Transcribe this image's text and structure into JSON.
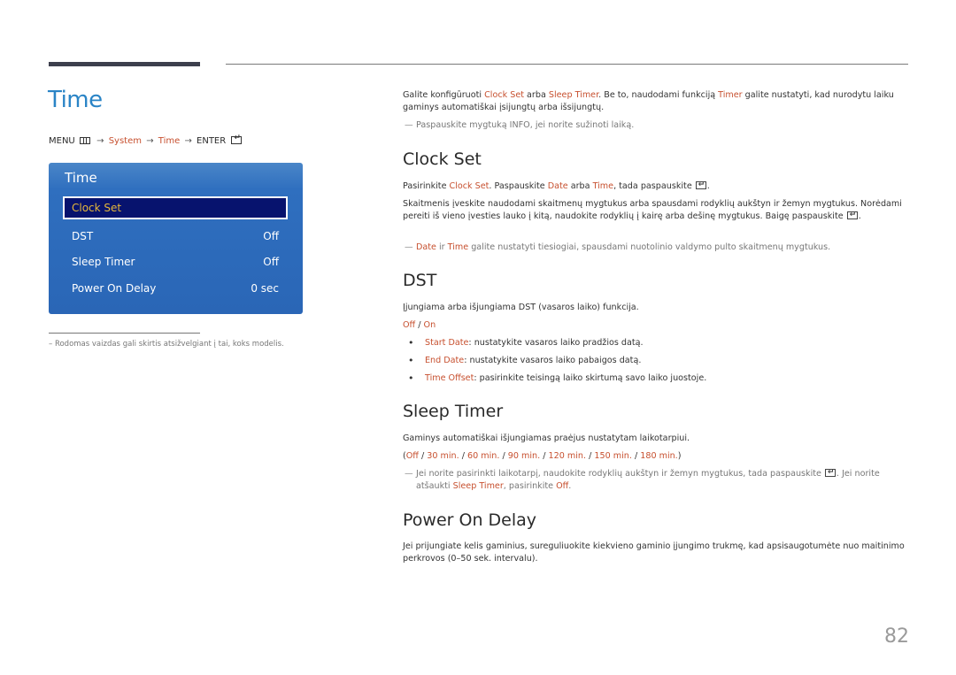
{
  "header": {
    "title": "Time",
    "menu_path": {
      "menu": "MENU",
      "menu_icon": "menu-grid-icon",
      "system": "System",
      "time": "Time",
      "enter": "ENTER",
      "enter_icon": "enter-icon",
      "arrow": "→"
    }
  },
  "osd": {
    "title": "Time",
    "items": [
      {
        "label": "Clock Set",
        "value": "",
        "selected": true
      },
      {
        "label": "DST",
        "value": "Off"
      },
      {
        "label": "Sleep Timer",
        "value": "Off"
      },
      {
        "label": "Power On Delay",
        "value": "0 sec"
      }
    ]
  },
  "footnote": "–  Rodomas vaizdas gali skirtis atsižvelgiant į tai, koks modelis.",
  "intro": {
    "t1": "Galite konfigūruoti ",
    "clock_set": "Clock Set",
    "t2": " arba ",
    "sleep_timer": "Sleep Timer",
    "t3": ". Be to, naudodami funkciją ",
    "timer": "Timer",
    "t4": " galite nustatyti, kad nurodytu laiku gaminys automatiškai įsijungtų arba išsijungtų.",
    "note": "Paspauskite mygtuką INFO, jei norite sužinoti laiką."
  },
  "clock_set": {
    "heading": "Clock Set",
    "p1_a": "Pasirinkite ",
    "p1_clock": "Clock Set",
    "p1_b": ". Paspauskite ",
    "p1_date": "Date",
    "p1_c": " arba ",
    "p1_time": "Time",
    "p1_d": ", tada paspauskite ",
    "p1_e": ".",
    "p2": "Skaitmenis įveskite naudodami skaitmenų mygtukus arba spausdami rodyklių aukštyn ir žemyn mygtukus. Norėdami pereiti iš vieno įvesties lauko į kitą, naudokite rodyklių į kairę arba dešinę mygtukus. Baigę paspauskite",
    "p2_end": ".",
    "note_date": "Date",
    "note_a": " ir ",
    "note_time": "Time",
    "note_b": " galite nustatyti tiesiogiai, spausdami nuotolinio valdymo pulto skaitmenų mygtukus."
  },
  "dst": {
    "heading": "DST",
    "p1": "Įjungiama arba išjungiama DST (vasaros laiko) funkcija.",
    "opt_off": "Off",
    "opt_sep": " / ",
    "opt_on": "On",
    "bullets": [
      {
        "term": "Start Date",
        "text": ": nustatykite vasaros laiko pradžios datą."
      },
      {
        "term": "End Date",
        "text": ": nustatykite vasaros laiko pabaigos datą."
      },
      {
        "term": "Time Offset",
        "text": ": pasirinkite teisingą laiko skirtumą savo laiko juostoje."
      }
    ]
  },
  "sleep_timer": {
    "heading": "Sleep Timer",
    "p1": "Gaminys automatiškai išjungiamas praėjus nustatytam laikotarpiui.",
    "open": "(",
    "close": ")",
    "sep": " / ",
    "options": [
      "Off",
      "30 min.",
      "60 min.",
      "90 min.",
      "120 min.",
      "150 min.",
      "180 min."
    ],
    "note_a": "Jei norite pasirinkti laikotarpį, naudokite rodyklių aukštyn ir žemyn mygtukus, tada paspauskite ",
    "note_b": ". Jei norite atšaukti ",
    "note_sleep": "Sleep Timer",
    "note_c": ", pasirinkite ",
    "note_off": "Off",
    "note_d": "."
  },
  "power_on_delay": {
    "heading": "Power On Delay",
    "p1": "Jei prijungiate kelis gaminius, sureguliuokite kiekvieno gaminio įjungimo trukmę, kad apsisaugotumėte nuo maitinimo perkrovos (0–50 sek. intervalu)."
  },
  "page_number": "82",
  "colors": {
    "title_blue": "#2a84c6",
    "accent": "#c7502f",
    "osd_blue": "#2a66b6",
    "osd_selected": "#07136e",
    "osd_selected_text": "#e6b73a"
  }
}
